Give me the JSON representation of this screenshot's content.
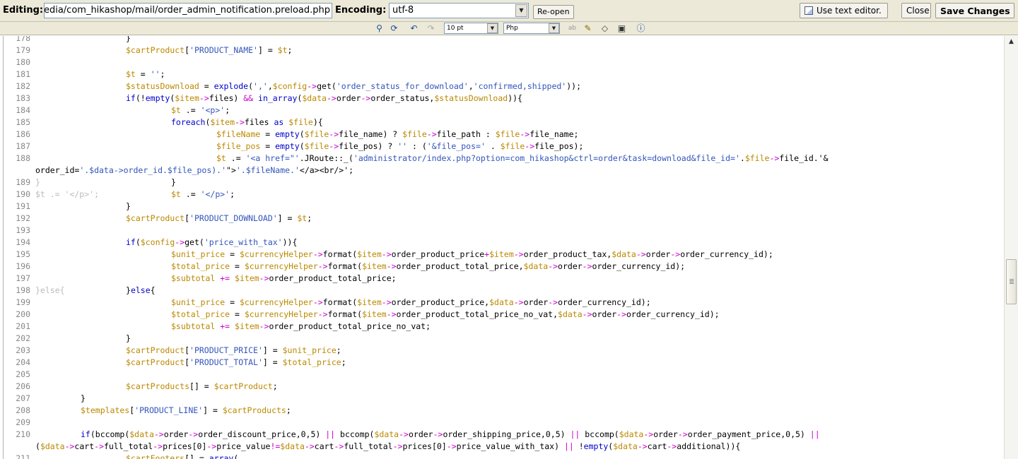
{
  "header": {
    "editing_label": "Editing:",
    "file_path": "edia/com_hikashop/mail/order_admin_notification.preload.php",
    "encoding_label": "Encoding:",
    "encoding_value": "utf-8",
    "reopen_label": "Re-open",
    "text_editor_label": "Use text editor.",
    "close_label": "Close",
    "save_label": "Save Changes"
  },
  "toolbar": {
    "font_size": "10 pt",
    "syntax": "Php",
    "icons": [
      "search-icon",
      "replace-icon",
      "undo-icon",
      "redo-icon",
      "spellcheck-icon",
      "highlight-icon",
      "reset-icon",
      "fullscreen-icon",
      "help-icon"
    ]
  },
  "editor": {
    "lines": [
      {
        "n": "178",
        "text": "\t\t}"
      },
      {
        "n": "179",
        "text": "\t\t$cartProduct['PRODUCT_NAME'] = $t;"
      },
      {
        "n": "180",
        "text": ""
      },
      {
        "n": "181",
        "text": "\t\t$t = '';"
      },
      {
        "n": "182",
        "text": "\t\t$statusDownload = explode(',',$config->get('order_status_for_download','confirmed,shipped'));"
      },
      {
        "n": "183",
        "text": "\t\tif(!empty($item->files) && in_array($data->order->order_status,$statusDownload)){"
      },
      {
        "n": "184",
        "text": "\t\t\t$t .= '<p>';"
      },
      {
        "n": "185",
        "text": "\t\t\tforeach($item->files as $file){"
      },
      {
        "n": "186",
        "text": "\t\t\t\t$fileName = empty($file->file_name) ? $file->file_path : $file->file_name;"
      },
      {
        "n": "187",
        "text": "\t\t\t\t$file_pos = empty($file->file_pos) ? '' : ('&file_pos=' . $file->file_pos);"
      },
      {
        "n": "188",
        "text": "\t\t\t\t$t .= '<a href=\"'.JRoute::_('administrator/index.php?option=com_hikashop&ctrl=order&task=download&file_id='.$file->file_id.'&"
      },
      {
        "n": "",
        "text": "order_id='.$data->order_id.$file_pos).'\">'.$fileName.'</a><br/>';"
      },
      {
        "n": "189",
        "text": "\t\t\t}",
        "ghost": "}"
      },
      {
        "n": "190",
        "text": "\t\t\t$t .= '</p>';",
        "ghost": "$t .= '</p>';"
      },
      {
        "n": "191",
        "text": "\t\t}"
      },
      {
        "n": "192",
        "text": "\t\t$cartProduct['PRODUCT_DOWNLOAD'] = $t;"
      },
      {
        "n": "193",
        "text": ""
      },
      {
        "n": "194",
        "text": "\t\tif($config->get('price_with_tax')){"
      },
      {
        "n": "195",
        "text": "\t\t\t$unit_price = $currencyHelper->format($item->order_product_price+$item->order_product_tax,$data->order->order_currency_id);"
      },
      {
        "n": "196",
        "text": "\t\t\t$total_price = $currencyHelper->format($item->order_product_total_price,$data->order->order_currency_id);"
      },
      {
        "n": "197",
        "text": "\t\t\t$subtotal += $item->order_product_total_price;"
      },
      {
        "n": "198",
        "text": "\t\t}else{",
        "ghost": "}else{"
      },
      {
        "n": "199",
        "text": "\t\t\t$unit_price = $currencyHelper->format($item->order_product_price,$data->order->order_currency_id);"
      },
      {
        "n": "200",
        "text": "\t\t\t$total_price = $currencyHelper->format($item->order_product_total_price_no_vat,$data->order->order_currency_id);"
      },
      {
        "n": "201",
        "text": "\t\t\t$subtotal += $item->order_product_total_price_no_vat;"
      },
      {
        "n": "202",
        "text": "\t\t}"
      },
      {
        "n": "203",
        "text": "\t\t$cartProduct['PRODUCT_PRICE'] = $unit_price;"
      },
      {
        "n": "204",
        "text": "\t\t$cartProduct['PRODUCT_TOTAL'] = $total_price;"
      },
      {
        "n": "205",
        "text": ""
      },
      {
        "n": "206",
        "text": "\t\t$cartProducts[] = $cartProduct;"
      },
      {
        "n": "207",
        "text": "\t}"
      },
      {
        "n": "208",
        "text": "\t$templates['PRODUCT_LINE'] = $cartProducts;"
      },
      {
        "n": "209",
        "text": ""
      },
      {
        "n": "210",
        "text": "\tif(bccomp($data->order->order_discount_price,0,5) || bccomp($data->order->order_shipping_price,0,5) || bccomp($data->order->order_payment_price,0,5) ||"
      },
      {
        "n": "",
        "text": "($data->cart->full_total->prices[0]->price_value!=$data->cart->full_total->prices[0]->price_value_with_tax) || !empty($data->cart->additional)){"
      },
      {
        "n": "211",
        "text": "\t\t$cartFooters[] = array("
      }
    ]
  }
}
